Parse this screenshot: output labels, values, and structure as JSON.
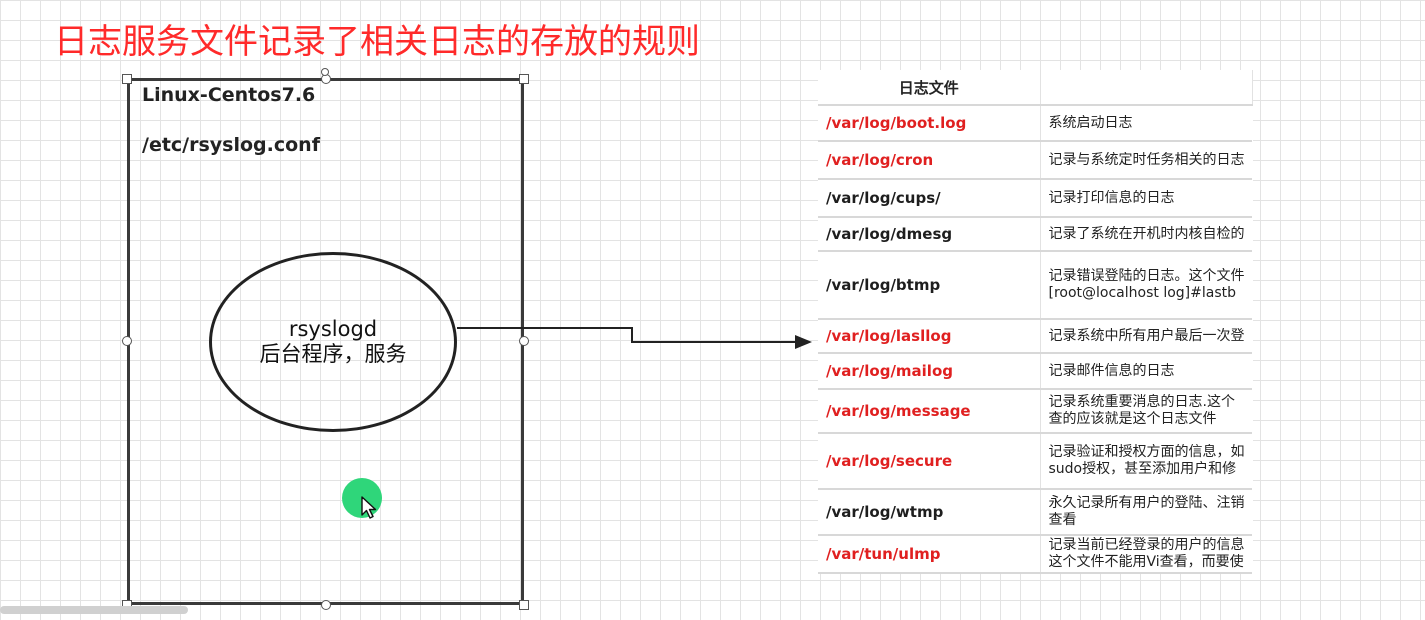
{
  "title": "日志服务文件记录了相关日志的存放的规则",
  "server_box": {
    "os_label": "Linux-Centos7.6",
    "config_path": "/etc/rsyslog.conf"
  },
  "daemon": {
    "name": "rsyslogd",
    "description": "后台程序，服务"
  },
  "log_table": {
    "header": "日志文件",
    "header_desc": "",
    "rows": [
      {
        "path": "/var/log/boot.log",
        "highlight": true,
        "desc": [
          "系统启动日志"
        ]
      },
      {
        "path": "/var/log/cron",
        "highlight": true,
        "desc": [
          "记录与系统定时任务相关的日志"
        ]
      },
      {
        "path": "/var/log/cups/",
        "highlight": false,
        "desc": [
          "记录打印信息的日志"
        ]
      },
      {
        "path": "/var/log/dmesg",
        "highlight": false,
        "desc": [
          "记录了系统在开机时内核自检的"
        ]
      },
      {
        "path": "/var/log/btmp",
        "highlight": false,
        "desc": [
          "记录错误登陆的日志。这个文件",
          "[root@localhost log]#lastb"
        ]
      },
      {
        "path": "/var/log/lasllog",
        "highlight": true,
        "desc": [
          "记录系统中所有用户最后一次登"
        ]
      },
      {
        "path": "/var/log/mailog",
        "highlight": true,
        "desc": [
          "记录邮件信息的日志"
        ]
      },
      {
        "path": "/var/log/message",
        "highlight": true,
        "desc": [
          "记录系统重要消息的日志.这个",
          "查的应该就是这个日志文件"
        ]
      },
      {
        "path": "/var/log/secure",
        "highlight": true,
        "desc": [
          "记录验证和授权方面的信息，如",
          "sudo授权，甚至添加用户和修"
        ]
      },
      {
        "path": "/var/log/wtmp",
        "highlight": false,
        "desc": [
          "永久记录所有用户的登陆、注销",
          "查看"
        ]
      },
      {
        "path": "/var/tun/ulmp",
        "highlight": true,
        "desc": [
          "记录当前已经登录的用户的信息",
          "这个文件不能用Vi查看，而要使"
        ]
      }
    ]
  },
  "colors": {
    "title": "#ff2a2a",
    "highlight_path": "#e02020",
    "cursor_dot": "#2fd67a"
  },
  "icons": [
    "mouse-pointer-icon",
    "arrow-head-icon"
  ]
}
